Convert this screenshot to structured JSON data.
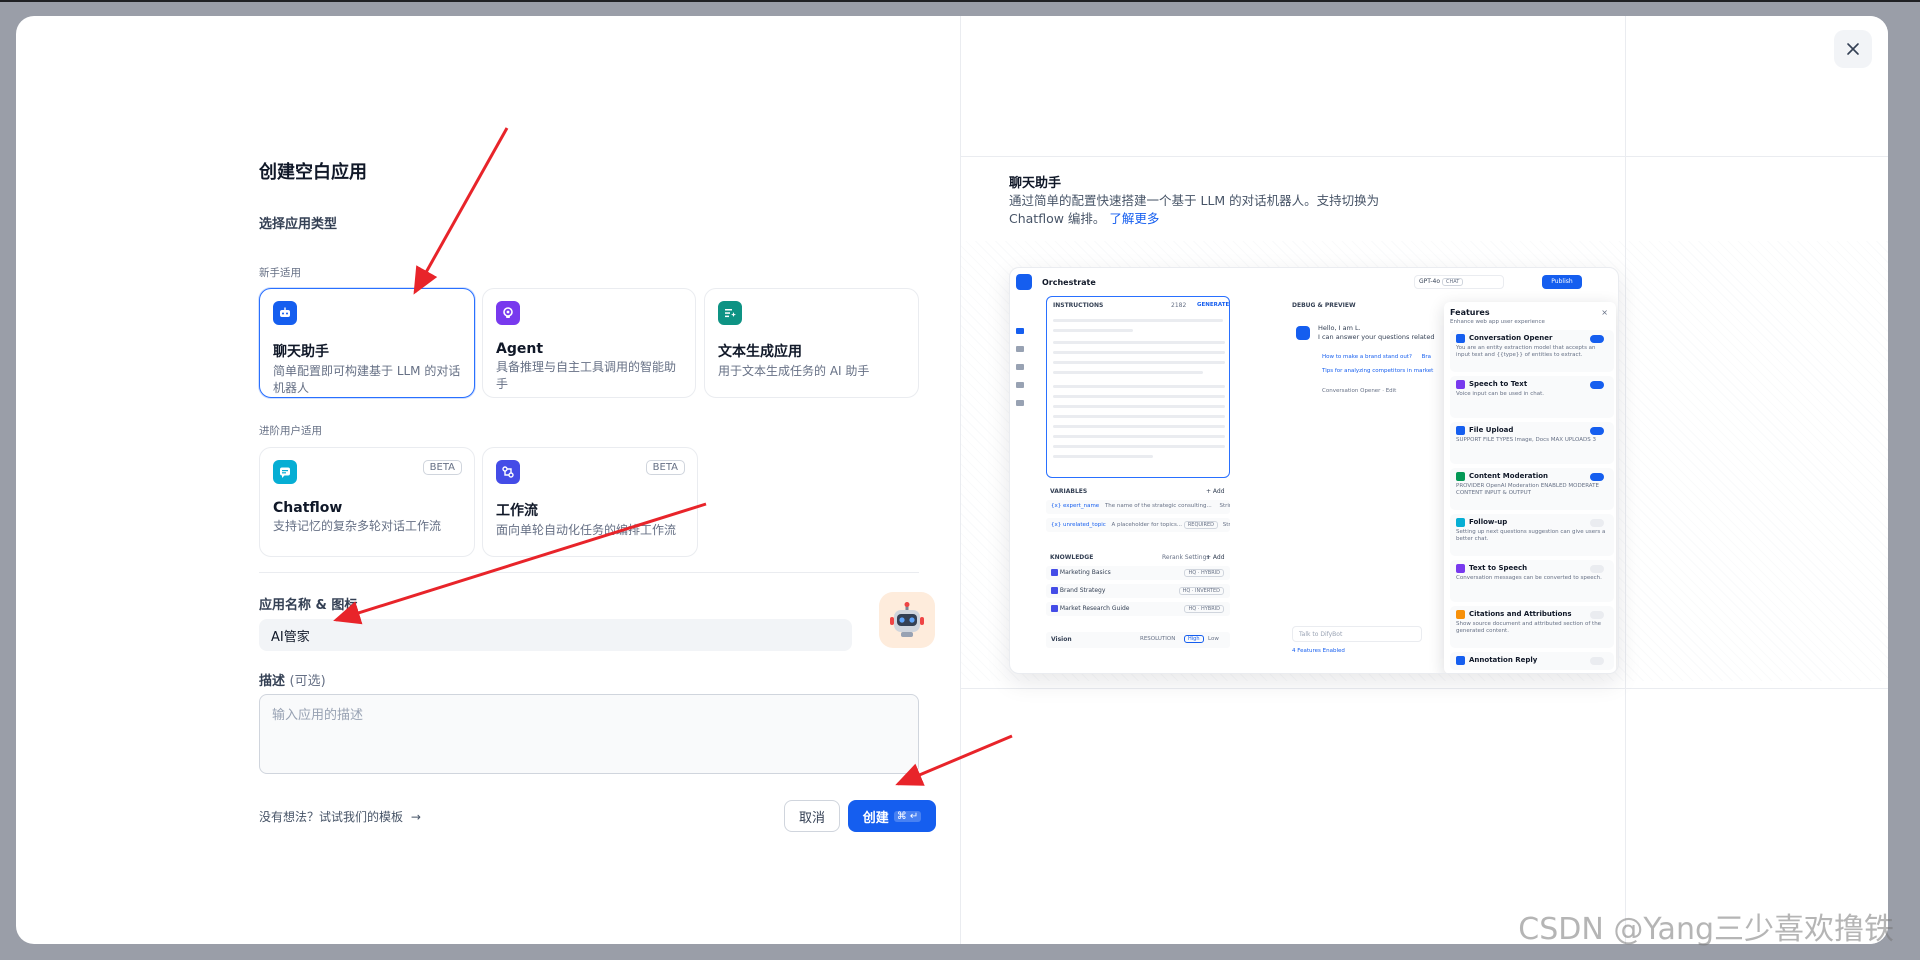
{
  "form": {
    "title": "创建空白应用",
    "section_title": "选择应用类型",
    "beginner_label": "新手适用",
    "advanced_label": "进阶用户适用",
    "app_types": [
      {
        "name": "聊天助手",
        "desc": "简单配置即可构建基于 LLM 的对话机器人",
        "icon": "chat-bot-icon",
        "color": "#155eef",
        "selected": true
      },
      {
        "name": "Agent",
        "desc": "具备推理与自主工具调用的智能助手",
        "icon": "agent-icon",
        "color": "#7839ee"
      },
      {
        "name": "文本生成应用",
        "desc": "用于文本生成任务的 AI 助手",
        "icon": "text-gen-icon",
        "color": "#0e9384"
      },
      {
        "name": "Chatflow",
        "desc": "支持记忆的复杂多轮对话工作流",
        "icon": "chatflow-icon",
        "color": "#06aed4",
        "badge": "BETA"
      },
      {
        "name": "工作流",
        "desc": "面向单轮自动化任务的编排工作流",
        "icon": "workflow-icon",
        "color": "#444ce7",
        "badge": "BETA"
      }
    ],
    "name_label": "应用名称 & 图标",
    "name_value": "AI管家",
    "avatar_icon": "robot-avatar-icon",
    "desc_label": "描述",
    "desc_optional": "(可选)",
    "desc_placeholder": "输入应用的描述",
    "template_link": "没有想法？试试我们的模板",
    "cancel_label": "取消",
    "create_label": "创建",
    "create_shortcut": "⌘ ↵"
  },
  "preview": {
    "title": "聊天助手",
    "desc": "通过简单的配置快速搭建一个基于 LLM 的对话机器人。支持切换为 Chatflow 编排。",
    "learn_more": "了解更多",
    "shot": {
      "header": "Orchestrate",
      "model": "GPT-4o",
      "model_tag": "CHAT",
      "publish": "Publish",
      "instructions": "INSTRUCTIONS",
      "instr_count": "2182",
      "generate": "GENERATE",
      "debug": "DEBUG & PREVIEW",
      "greeting_1": "Hello, I am L.",
      "greeting_2": "I can answer your questions related",
      "suggest_1": "How to make a brand stand out?",
      "suggest_2": "Tips for analyzing competitors in market",
      "suggest_3": "Bra",
      "opener_link": "Conversation Opener · Edit",
      "variables": "VARIABLES",
      "add": "+ Add",
      "var_1_name": "{x} expert_name",
      "var_1_desc": "The name of the strategic consulting...",
      "var_1_type": "String",
      "var_2_name": "{x} unrelated_topic",
      "var_2_desc": "A placeholder for topics...",
      "var_2_req": "REQUIRED",
      "var_2_type": "String",
      "knowledge": "KNOWLEDGE",
      "rerank": "Rerank Settings",
      "kb": [
        "Marketing Basics",
        "Brand Strategy",
        "Market Research Guide"
      ],
      "kb_tags": [
        "HQ · HYBRID",
        "HQ · INVERTED",
        "HQ · HYBRID"
      ],
      "vision": "Vision",
      "resolution": "RESOLUTION",
      "high": "High",
      "low": "Low",
      "talk_placeholder": "Talk to DifyBot",
      "features_enabled": "4 Features Enabled",
      "features_title": "Features",
      "features_sub": "Enhance web app user experience",
      "features": [
        {
          "name": "Conversation Opener",
          "desc": "You are an entity extraction model that accepts an input text and {{type}} of entities to extract.",
          "on": true,
          "color": "#155eef"
        },
        {
          "name": "Speech to Text",
          "desc": "Voice input can be used in chat.",
          "on": true,
          "color": "#7839ee"
        },
        {
          "name": "File Upload",
          "desc": "SUPPORT FILE TYPES  Image, Docs   MAX UPLOADS 3",
          "on": true,
          "color": "#155eef"
        },
        {
          "name": "Content Moderation",
          "desc": "PROVIDER OpenAI Moderation   ENABLED MODERATE CONTENT INPUT & OUTPUT",
          "on": true,
          "color": "#039855"
        },
        {
          "name": "Follow-up",
          "desc": "Setting up next questions suggestion can give users a better chat.",
          "on": false,
          "color": "#06aed4"
        },
        {
          "name": "Text to Speech",
          "desc": "Conversation messages can be converted to speech.",
          "on": false,
          "color": "#7839ee"
        },
        {
          "name": "Citations and Attributions",
          "desc": "Show source document and attributed section of the generated content.",
          "on": false,
          "color": "#f79009"
        },
        {
          "name": "Annotation Reply",
          "desc": "",
          "on": false,
          "color": "#155eef"
        }
      ]
    }
  },
  "watermark": "CSDN @Yang三少喜欢撸铁",
  "colors": {
    "accent": "#155eef",
    "arrow": "#e8242a"
  }
}
